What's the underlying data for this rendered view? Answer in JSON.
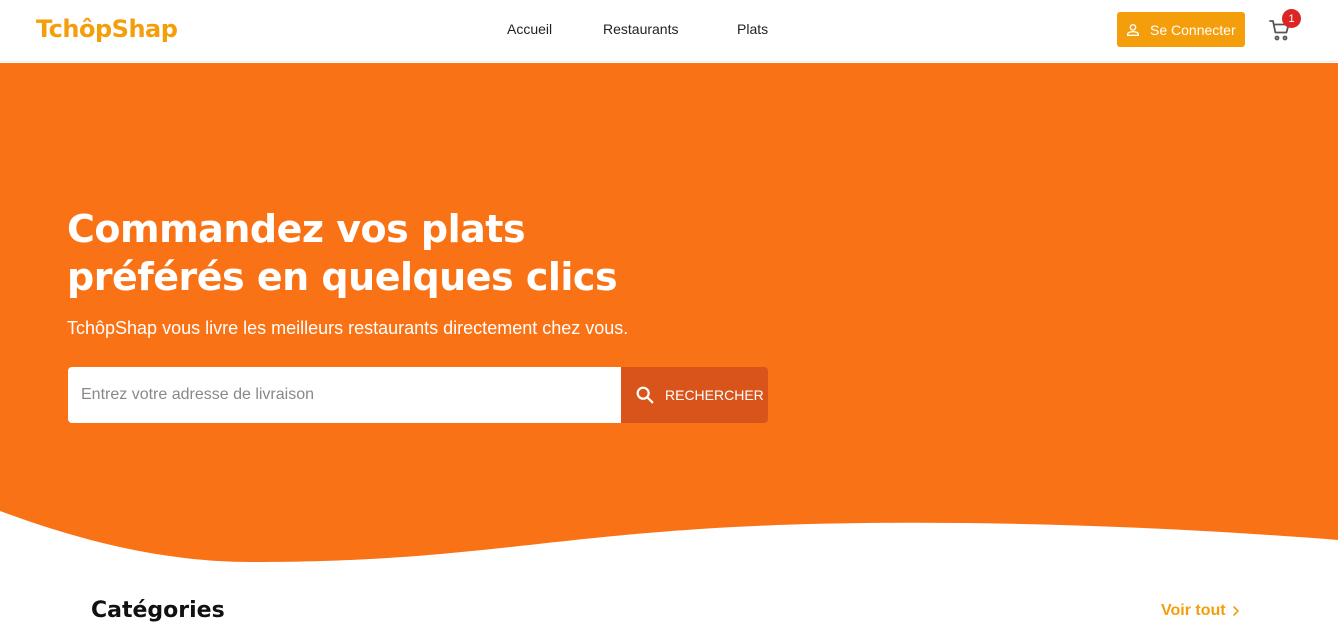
{
  "header": {
    "logo": "TchôpShap",
    "nav": [
      {
        "label": "Accueil"
      },
      {
        "label": "Restaurants"
      },
      {
        "label": "Plats"
      }
    ],
    "login_label": "Se Connecter",
    "login_icon": "user-icon",
    "cart_icon": "cart-icon",
    "cart_count": "1"
  },
  "hero": {
    "title_line1": "Commandez vos plats",
    "title_line2": "préférés en quelques clics",
    "subtitle": "TchôpShap vous livre les meilleurs restaurants directement chez vous.",
    "search": {
      "placeholder": "Entrez votre adresse de livraison",
      "value": "",
      "button_label": "RECHERCHER",
      "button_icon": "search-icon"
    }
  },
  "categories": {
    "title": "Catégories",
    "see_all_label": "Voir tout",
    "see_all_icon": "chevron-right-icon"
  },
  "colors": {
    "brand": "#f59e0b",
    "hero_bg": "#f97316",
    "search_button": "#d9541a",
    "badge": "#dc2626"
  }
}
